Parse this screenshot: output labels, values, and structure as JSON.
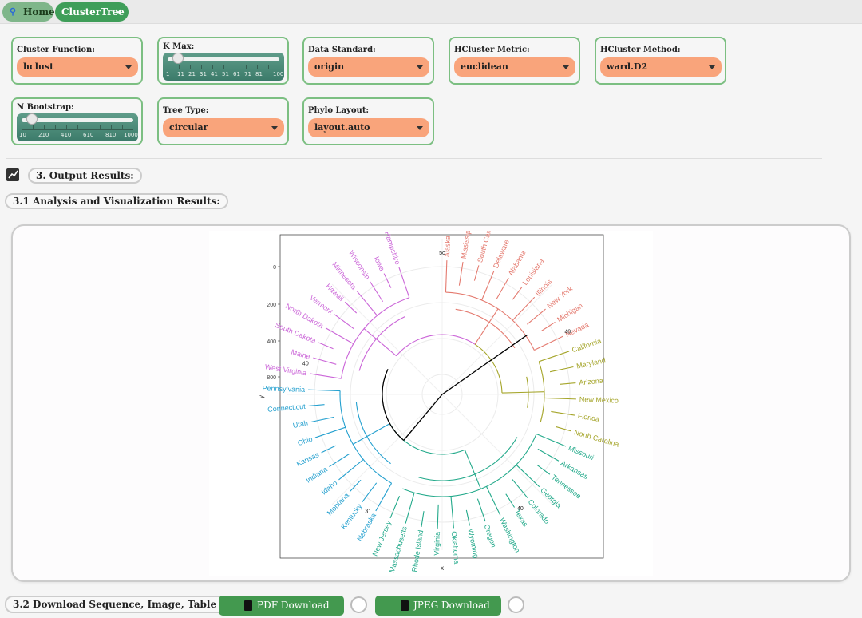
{
  "tabs": [
    {
      "label": "Home",
      "icon": "pin-icon"
    },
    {
      "label": "ClusterTree",
      "close": "×"
    }
  ],
  "controls": {
    "cluster_function": {
      "label": "Cluster Function:",
      "value": "hclust"
    },
    "k_max": {
      "label": "K Max:",
      "value": 11,
      "min": 1,
      "max": 100,
      "ticks": [
        "1",
        "11",
        "21",
        "31",
        "41",
        "51",
        "61",
        "71",
        "81",
        "100"
      ]
    },
    "data_standard": {
      "label": "Data Standard:",
      "value": "origin"
    },
    "hcluster_metric": {
      "label": "HCluster Metric:",
      "value": "euclidean"
    },
    "hcluster_method": {
      "label": "HCluster Method:",
      "value": "ward.D2"
    },
    "n_bootstrap": {
      "label": "N Bootstrap:",
      "value": 100,
      "min": 10,
      "max": 1000,
      "ticks": [
        "10",
        "210",
        "410",
        "610",
        "810",
        "1000"
      ]
    },
    "tree_type": {
      "label": "Tree Type:",
      "value": "circular"
    },
    "phylo_layout": {
      "label": "Phylo Layout:",
      "value": "layout.auto"
    }
  },
  "sections": {
    "output": "3. Output Results:",
    "analysis": "3.1 Analysis and Visualization Results:",
    "download": "3.2 Download Sequence, Image, Table Results:"
  },
  "buttons": {
    "pdf": "PDF Download",
    "jpeg": "JPEG Download"
  },
  "plot": {
    "xlabel": "x",
    "ylabel": "y",
    "yticks": [
      "0",
      "200",
      "400",
      "800"
    ],
    "colors": {
      "pink": "#e47a6f",
      "olive": "#a5a52a",
      "teal": "#22a98a",
      "blue": "#24a0cf",
      "magenta": "#cb66d8",
      "root": "#000000"
    },
    "clusters": [
      {
        "color_key": "pink",
        "leaves": [
          "Alaska",
          "Mississippi",
          "South Carolina",
          "Delaware",
          "Alabama",
          "Louisiana",
          "Illinois",
          "New York",
          "Michigan",
          "Nevada"
        ]
      },
      {
        "color_key": "olive",
        "leaves": [
          "California",
          "Maryland",
          "Arizona",
          "New Mexico",
          "Florida",
          "North Carolina"
        ]
      },
      {
        "color_key": "teal",
        "leaves": [
          "Missouri",
          "Arkansas",
          "Tennessee",
          "Georgia",
          "Colorado",
          "Texas",
          "Washington",
          "Oregon",
          "Wyoming",
          "Oklahoma",
          "Virginia",
          "Rhode Island",
          "Massachusetts",
          "New Jersey"
        ]
      },
      {
        "color_key": "blue",
        "leaves": [
          "Nebraska",
          "Kentucky",
          "Montana",
          "Idaho",
          "Indiana",
          "Kansas",
          "Ohio",
          "Utah",
          "Connecticut",
          "Pennsylvania"
        ]
      },
      {
        "color_key": "magenta",
        "leaves": [
          "West Virginia",
          "Maine",
          "South Dakota",
          "North Dakota",
          "Vermont",
          "Hawaii",
          "Minnesota",
          "Wisconsin",
          "Iowa",
          "New Hampshire"
        ]
      }
    ],
    "bootstrap_labels": [
      {
        "text": "50",
        "angle": 0
      },
      {
        "text": "40",
        "angle": 64
      },
      {
        "text": "40",
        "angle": 146
      },
      {
        "text": "31",
        "angle": 212
      },
      {
        "text": "40",
        "angle": 282
      }
    ]
  }
}
